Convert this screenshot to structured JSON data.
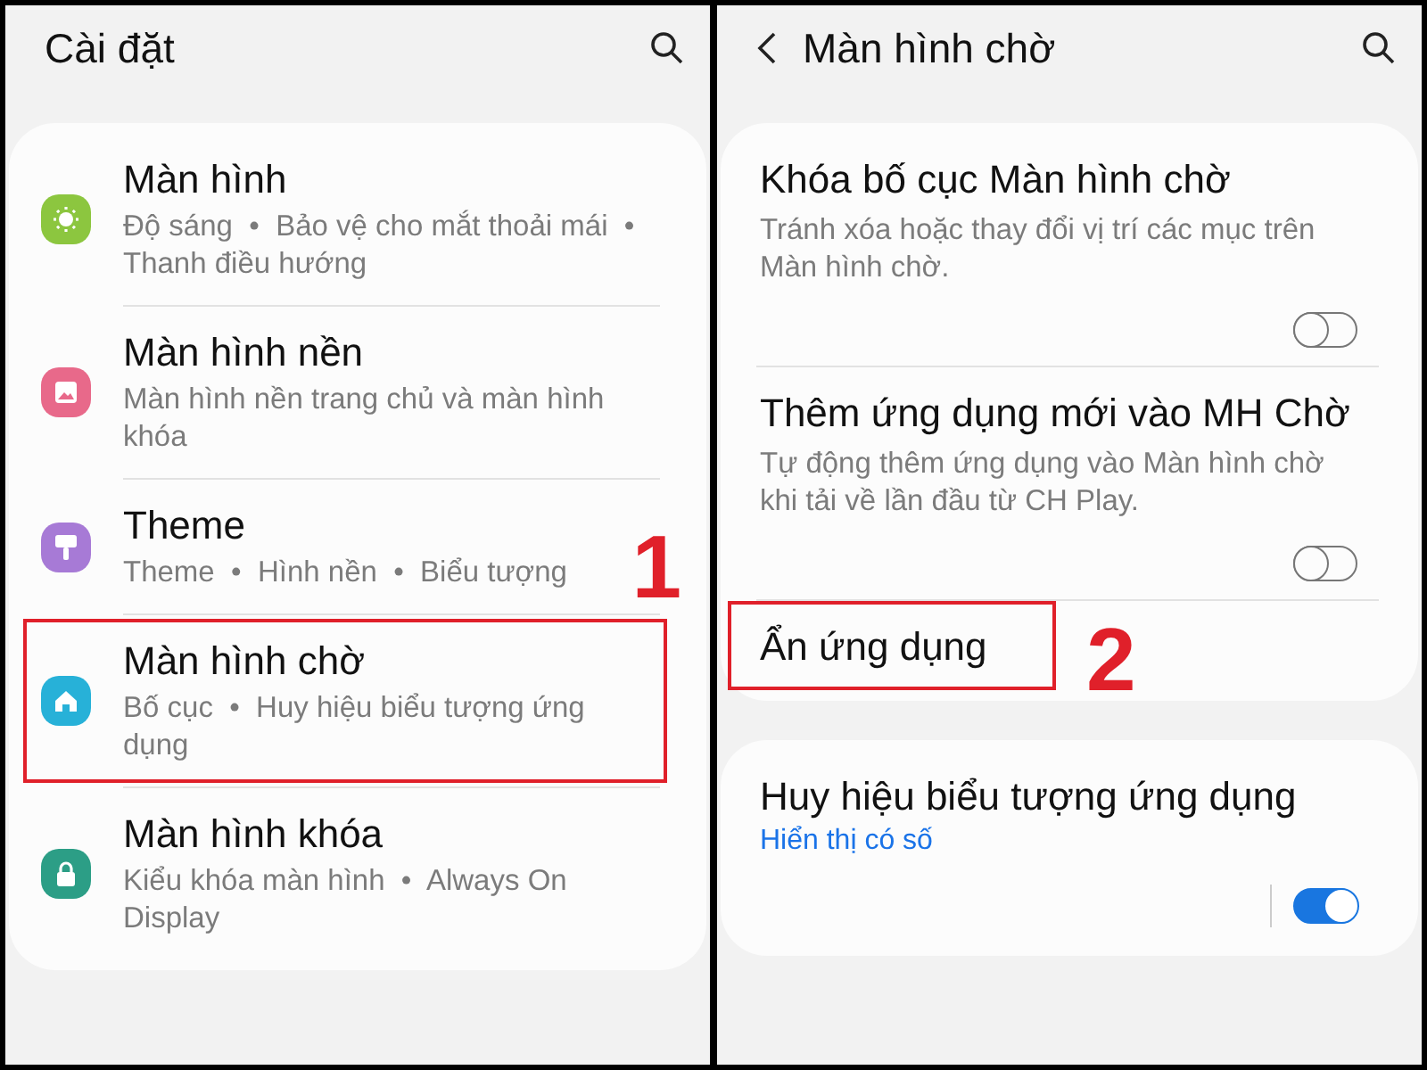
{
  "left_screen": {
    "title": "Cài đặt",
    "items": [
      {
        "kind": "sun",
        "color": "#8cc63f",
        "title": "Màn hình",
        "subtitle": "Độ sáng  •  Bảo vệ cho mắt thoải mái  •  Thanh điều hướng",
        "highlighted": false
      },
      {
        "kind": "image",
        "color": "#e8698a",
        "title": "Màn hình nền",
        "subtitle": "Màn hình nền trang chủ và màn hình khóa",
        "highlighted": false
      },
      {
        "kind": "brush",
        "color": "#a77ad6",
        "title": "Theme",
        "subtitle": "Theme  •  Hình nền  •  Biểu tượng",
        "highlighted": false
      },
      {
        "kind": "home",
        "color": "#27b1d8",
        "title": "Màn hình chờ",
        "subtitle": "Bố cục  •  Huy hiệu biểu tượng ứng dụng",
        "highlighted": true,
        "step": "1"
      },
      {
        "kind": "lock",
        "color": "#2c9e86",
        "title": "Màn hình khóa",
        "subtitle": "Kiểu khóa màn hình  •  Always On Display",
        "highlighted": false
      }
    ]
  },
  "right_screen": {
    "title": "Màn hình chờ",
    "cards": [
      [
        {
          "title": "Khóa bố cục Màn hình chờ",
          "description": "Tránh xóa hoặc thay đổi vị trí các mục trên Màn hình chờ.",
          "toggle": {
            "on": false
          },
          "highlighted": false
        },
        {
          "title": "Thêm ứng dụng mới vào MH Chờ",
          "description": "Tự động thêm ứng dụng vào Màn hình chờ khi tải về lần đầu từ CH Play.",
          "toggle": {
            "on": false
          },
          "highlighted": false
        },
        {
          "title": "Ẩn ứng dụng",
          "highlighted": true,
          "step": "2"
        }
      ],
      [
        {
          "title": "Huy hiệu biểu tượng ứng dụng",
          "value": "Hiển thị có số",
          "toggle": {
            "on": true
          },
          "highlighted": false
        }
      ]
    ]
  }
}
